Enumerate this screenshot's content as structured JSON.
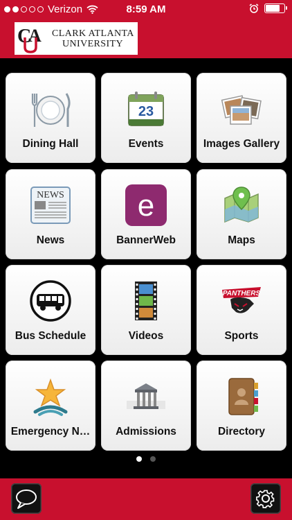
{
  "status_bar": {
    "carrier": "Verizon",
    "time": "8:59 AM",
    "signal_bars_filled": 2,
    "signal_bars_total": 5,
    "battery_level": 0.85,
    "icons": [
      "wifi-icon",
      "alarm-icon",
      "battery-icon"
    ]
  },
  "header": {
    "logo_line1": "Clark Atlanta",
    "logo_line2": "University",
    "logo_monogram": "CAU"
  },
  "tiles": [
    {
      "label": "Dining Hall",
      "icon": "dining-plate-icon"
    },
    {
      "label": "Events",
      "icon": "calendar-icon",
      "icon_text": "23"
    },
    {
      "label": "Images Gallery",
      "icon": "photos-icon"
    },
    {
      "label": "News",
      "icon": "newspaper-icon",
      "icon_text": "NEWS"
    },
    {
      "label": "BannerWeb",
      "icon": "bannerweb-icon",
      "icon_text": "e"
    },
    {
      "label": "Maps",
      "icon": "map-icon"
    },
    {
      "label": "Bus Schedule",
      "icon": "bus-icon"
    },
    {
      "label": "Videos",
      "icon": "film-strip-icon"
    },
    {
      "label": "Sports",
      "icon": "panthers-logo-icon",
      "icon_text": "PANTHERS"
    },
    {
      "label": "Emergency N…",
      "icon": "emergency-star-icon"
    },
    {
      "label": "Admissions",
      "icon": "building-icon"
    },
    {
      "label": "Directory",
      "icon": "address-book-icon"
    }
  ],
  "pager": {
    "pages": 2,
    "current": 1
  },
  "bottom_bar": {
    "left_button_icon": "chat-bubble-icon",
    "right_button_icon": "gear-icon"
  },
  "colors": {
    "brand_red": "#c8102e",
    "background": "#000000",
    "tile_bg": "#f4f4f4",
    "bannerweb_purple": "#8e2a6f"
  }
}
